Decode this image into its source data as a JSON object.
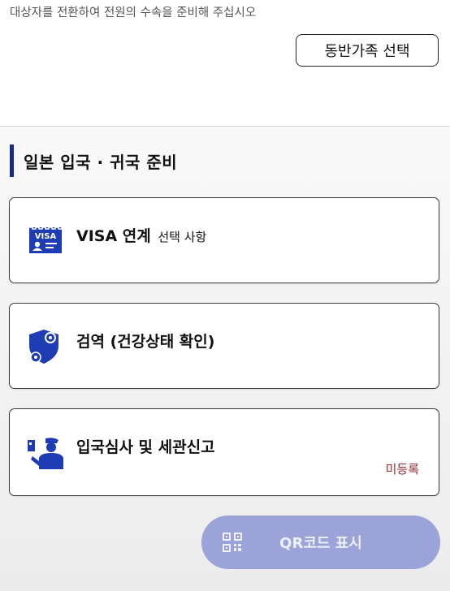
{
  "header": {
    "instruction": "대상자를 전환하여 전원의 수속을 준비해 주십시오",
    "family_button": "동반가족 선택"
  },
  "section": {
    "title": "일본 입국 · 귀국 준비"
  },
  "cards": [
    {
      "label": "VISA 연계",
      "sub": "선택 사항",
      "icon": "visa-card-icon"
    },
    {
      "label": "검역 (건강상태 확인)",
      "icon": "shield-gear-icon"
    },
    {
      "label": "입국심사 및 세관신고",
      "status": "미등록",
      "icon": "officer-passport-icon"
    }
  ],
  "footer": {
    "qr_button": "QR코드 표시",
    "qr_icon": "qr-code-icon"
  },
  "colors": {
    "accent": "#1a2a8a",
    "icon_blue": "#1e3cb4",
    "status_red": "#9a2a2a",
    "qr_button_bg": "#9ba3d9"
  }
}
